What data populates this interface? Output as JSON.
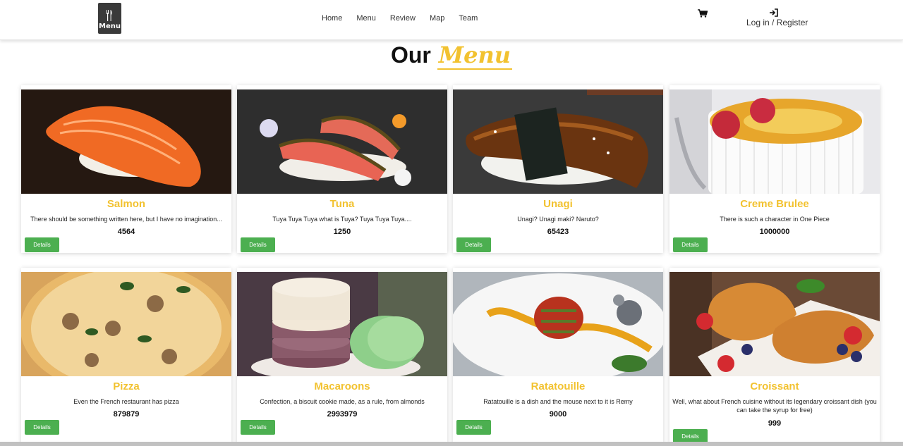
{
  "header": {
    "logo_text": "Menu",
    "nav": [
      "Home",
      "Menu",
      "Review",
      "Map",
      "Team"
    ],
    "login_label": "Log in / Register"
  },
  "title": {
    "main": "Our",
    "accent": "Menu"
  },
  "cards": [
    {
      "name": "Salmon",
      "desc": "There should be something written here, but I have no imagination...",
      "price": "4564",
      "button": "Details"
    },
    {
      "name": "Tuna",
      "desc": "Tuya Tuya Tuya what is Tuya? Tuya Tuya Tuya....",
      "price": "1250",
      "button": "Details"
    },
    {
      "name": "Unagi",
      "desc": "Unagi? Unagi maki? Naruto?",
      "price": "65423",
      "button": "Details"
    },
    {
      "name": "Creme Brulee",
      "desc": "There is such a character in One Piece",
      "price": "1000000",
      "button": "Details"
    },
    {
      "name": "Pizza",
      "desc": "Even the French restaurant has pizza",
      "price": "879879",
      "button": "Details"
    },
    {
      "name": "Macaroons",
      "desc": "Confection, a biscuit cookie made, as a rule, from almonds",
      "price": "2993979",
      "button": "Details"
    },
    {
      "name": "Ratatouille",
      "desc": "Ratatouille is a dish and the mouse next to it is Remy",
      "price": "9000",
      "button": "Details"
    },
    {
      "name": "Croissant",
      "desc": "Well, what about French cuisine without its legendary croissant dish (you can take the syrup for free)",
      "price": "999",
      "button": "Details"
    }
  ],
  "colors": {
    "accent": "#f2c230",
    "button": "#4caf50"
  },
  "icons": [
    "cart-icon",
    "login-icon",
    "fork-knife-icon"
  ]
}
